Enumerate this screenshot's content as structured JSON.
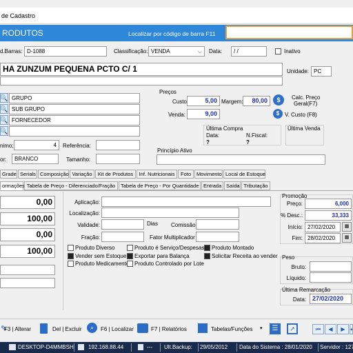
{
  "window": {
    "title": "de Cadastro"
  },
  "header": {
    "title": "RODUTOS",
    "barcode_search_label": "Localizar por código de barra F11",
    "barcode_search_value": ""
  },
  "top": {
    "barcode_label": "d.Barras:",
    "barcode_value": "D-1088",
    "classification_label": "Classificação:",
    "classification_value": "VENDA",
    "date_label": "Data:",
    "date_value": "/ /",
    "inactive_label": "Inativo"
  },
  "product": {
    "name": "HA ZUNZUM PEQUENA PCTO C/ 1",
    "unit_label": "Unidade:",
    "unit_value": "PC"
  },
  "groups": {
    "group": "GRUPO",
    "subgroup": "SUB GRUPO",
    "supplier": "FORNECEDOR"
  },
  "left_fields": {
    "minimum_label": "nimo:",
    "minimum_value": "4",
    "reference_label": "Referência:",
    "color_label": "or:",
    "color_value": "BRANCO",
    "size_label": "Tamanho:"
  },
  "prices": {
    "section_label": "Preços",
    "cost_label": "Custo",
    "cost_value": "5,00",
    "margin_label": "Margem:",
    "margin_value": "80,00",
    "calc_label_1": "Calc. Preço",
    "calc_label_2": "Geral(F7)",
    "sale_label": "Venda:",
    "sale_value": "9,00",
    "vcost_label": "V. Custo (F8)"
  },
  "last_purchase": {
    "title": "Última Compra",
    "date_label": "Data:",
    "date_value": "?",
    "invoice_label": "N.Fiscal:",
    "invoice_value": "?"
  },
  "last_sale": {
    "title": "Última Venda"
  },
  "active_principle": {
    "label": "Princípio Ativo"
  },
  "tabs_row1": [
    "Grade",
    "Serials",
    "Composição",
    "Variação",
    "Kit de Produtos",
    "Inf. Nutricionais",
    "Foto",
    "Movimento",
    "Local de Estoque"
  ],
  "tabs_row2": [
    "ormações",
    "Tabela de Preço - Diferenciado/Fração",
    "Tabela de Preço - Por Quantidade",
    "Entrada",
    "Saída",
    "Tributação"
  ],
  "stock_values": [
    "0,00",
    "100,00",
    "0,00",
    "100,00"
  ],
  "info": {
    "application_label": "Aplicação:",
    "location_label": "Localização:",
    "validity_label": "Validade:",
    "days_label": "Dias",
    "commission_label": "Comissão:",
    "fraction_label": "Fração:",
    "multiplier_label": "Fator Multiplicador"
  },
  "checkboxes": [
    {
      "label": "Produto Diverso",
      "checked": false
    },
    {
      "label": "Produto é Serviço/Despesas",
      "checked": false
    },
    {
      "label": "Produto Montado",
      "checked": true
    },
    {
      "label": "Vender sem Estoque",
      "checked": true
    },
    {
      "label": "Exportar para Balança",
      "checked": true
    },
    {
      "label": "Solicitar Receita ao vender",
      "checked": true
    },
    {
      "label": "Produto Medicamento",
      "checked": false
    },
    {
      "label": "Produto Controlado por Lote",
      "checked": false
    }
  ],
  "promotion": {
    "title": "Promoção",
    "price_label": "Preço:",
    "price_value": "6,000",
    "discount_label": "% Desc.:",
    "discount_value": "33,333",
    "start_label": "Início:",
    "start_value": "27/02/2020",
    "end_label": "Fim:",
    "end_value": "28/02/2020"
  },
  "weight": {
    "title": "Peso",
    "gross_label": "Bruto:",
    "net_label": "Líquido:"
  },
  "remark": {
    "title": "Última Remarcação",
    "date_label": "Data:",
    "date_value": "27/02/2020"
  },
  "toolbar": {
    "alter": "F3 | Alterar",
    "delete": "Del | Excluir",
    "locate": "F6 | Localizar",
    "reports": "F7 | Relatórios",
    "tables": "Tabelas/Funções"
  },
  "statusbar": {
    "machine": "DESKTOP-D4MMBSH",
    "ip": "192.168.88.44",
    "blank": "---",
    "backup_label": "Ult.Backup:",
    "backup_date": "29/05/2012",
    "system_date": "Data do Sistema : 28/01/2020",
    "server": "Servidor : 127.0"
  },
  "colors": {
    "header_blue": "#2e87d8",
    "barcode_box_border": "#e5a03a",
    "value_blue": "#1d2fb3",
    "status_bg": "#1a2a4a"
  }
}
